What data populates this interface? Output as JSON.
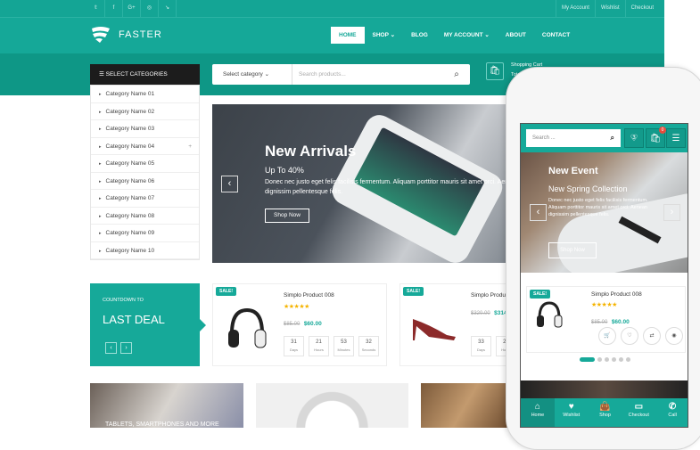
{
  "topbar": {
    "social": [
      "𝕥",
      "f",
      "G+",
      "◎",
      "↘"
    ],
    "account": "My Account",
    "wishlist": "Wishlist",
    "checkout": "Checkout"
  },
  "logo": "FASTER",
  "nav": [
    "HOME",
    "SHOP ⌄",
    "BLOG",
    "MY ACCOUNT ⌄",
    "ABOUT",
    "CONTACT"
  ],
  "categories": {
    "title": "SELECT CATEGORIES",
    "items": [
      "Category Name 01",
      "Category Name 02",
      "Category Name 03",
      "Category Name 04",
      "Category Name 05",
      "Category Name 06",
      "Category Name 07",
      "Category Name 08",
      "Category Name 09",
      "Category Name 10"
    ]
  },
  "search": {
    "category": "Select category ⌄",
    "placeholder": "Search products..."
  },
  "cart": {
    "label": "Shopping Cart",
    "total": "Total"
  },
  "slider": {
    "title": "New Arrivals",
    "subtitle": "Up To 40%",
    "desc": "Donec nec justo eget felis facilisis fermentum. Aliquam porttitor mauris sit amet orci. Aenean dignissim pellentesque felis.",
    "button": "Shop Now"
  },
  "deal": {
    "small": "COUNTDOWN TO",
    "big": "LAST DEAL"
  },
  "products": [
    {
      "sale": "SALE!",
      "name": "Simplo Product 008",
      "old": "$85.00",
      "new": "$60.00",
      "timer": [
        [
          "31",
          "Days"
        ],
        [
          "21",
          "Hours"
        ],
        [
          "53",
          "Minutes"
        ],
        [
          "32",
          "Seconds"
        ]
      ]
    },
    {
      "sale": "SALE!",
      "name": "Simplo Product 008",
      "old": "$320.00",
      "new": "$314.00",
      "timer": [
        [
          "33",
          "Days"
        ],
        [
          "21",
          "Hours"
        ]
      ]
    }
  ],
  "banners": [
    "TABLETS, SMARTPHONES AND MORE"
  ],
  "mobile": {
    "search": "Search ...",
    "wish_count": "3",
    "cart_count": "0",
    "slide_title": "New Event",
    "slide_sub": "New Spring Collection",
    "slide_desc": "Donec nec justo eget felis facilisis fermentum. Aliquam porttitor mauris sit amet orci. Aenean dignissim pellentesque felis.",
    "button": "Shop Now",
    "product": {
      "sale": "SALE!",
      "name": "Simplo Product 008",
      "old": "$85.00",
      "new": "$60.00"
    },
    "bottom": [
      "Home",
      "Wishlist",
      "Shop",
      "Checkout",
      "Call"
    ]
  },
  "colors": {
    "accent": "#16a999"
  }
}
